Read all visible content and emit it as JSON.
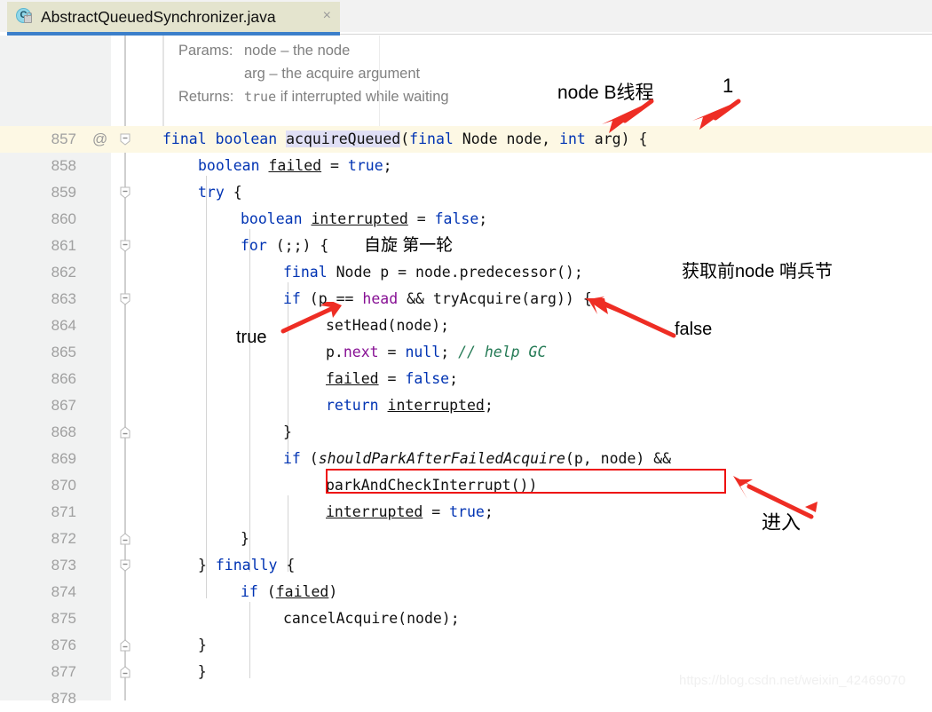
{
  "tab": {
    "title": "AbstractQueuedSynchronizer.java",
    "icon": "java-class-icon",
    "icon_letter": "C",
    "close_label": "×",
    "accent_color": "#3c7fca",
    "background_color": "#e4e4ce"
  },
  "doc_popup": {
    "rows": [
      {
        "label": "Params:",
        "value": "node – the node"
      },
      {
        "label": "",
        "value": "arg – the acquire argument"
      },
      {
        "label": "Returns:",
        "value_mono": "true",
        "value": " if interrupted while waiting"
      }
    ]
  },
  "editor": {
    "highlight_line": 857,
    "lines": [
      {
        "no": "857",
        "at": "@",
        "fold": "down",
        "highlight": true,
        "text": "    final boolean acquireQueued(final Node node, int arg) {"
      },
      {
        "no": "858",
        "at": "",
        "fold": "",
        "text": "        boolean failed = true;"
      },
      {
        "no": "859",
        "at": "",
        "fold": "down",
        "text": "        try {"
      },
      {
        "no": "860",
        "at": "",
        "fold": "",
        "text": "            boolean interrupted = false;"
      },
      {
        "no": "861",
        "at": "",
        "fold": "down",
        "text": "            for (;;) {"
      },
      {
        "no": "862",
        "at": "",
        "fold": "",
        "text": "                final Node p = node.predecessor();"
      },
      {
        "no": "863",
        "at": "",
        "fold": "down",
        "text": "                if (p == head && tryAcquire(arg)) {"
      },
      {
        "no": "864",
        "at": "",
        "fold": "",
        "text": "                    setHead(node);"
      },
      {
        "no": "865",
        "at": "",
        "fold": "",
        "text": "                    p.next = null; // help GC"
      },
      {
        "no": "866",
        "at": "",
        "fold": "",
        "text": "                    failed = false;"
      },
      {
        "no": "867",
        "at": "",
        "fold": "",
        "text": "                    return interrupted;"
      },
      {
        "no": "868",
        "at": "",
        "fold": "up",
        "text": "                }"
      },
      {
        "no": "869",
        "at": "",
        "fold": "",
        "text": "                if (shouldParkAfterFailedAcquire(p, node) &&"
      },
      {
        "no": "870",
        "at": "",
        "fold": "",
        "text": "                    parkAndCheckInterrupt())"
      },
      {
        "no": "871",
        "at": "",
        "fold": "",
        "text": "                    interrupted = true;"
      },
      {
        "no": "872",
        "at": "",
        "fold": "up",
        "text": "            }"
      },
      {
        "no": "873",
        "at": "",
        "fold": "down",
        "text": "        } finally {"
      },
      {
        "no": "874",
        "at": "",
        "fold": "",
        "text": "            if (failed)"
      },
      {
        "no": "875",
        "at": "",
        "fold": "",
        "text": "                cancelAcquire(node);"
      },
      {
        "no": "876",
        "at": "",
        "fold": "up",
        "text": "        }"
      },
      {
        "no": "877",
        "at": "",
        "fold": "up",
        "text": "    }"
      },
      {
        "no": "878",
        "at": "",
        "fold": "",
        "text": ""
      }
    ],
    "inline_comment_861": "自旋 第一轮"
  },
  "annotations": {
    "node_b_thread": "node B线程",
    "one": "1",
    "true_label": "true",
    "false_label": "false",
    "get_prev_node": "获取前node 哨兵节",
    "enter": "进入",
    "arrow_color": "#ee2d24",
    "box_color": "#ee1111"
  },
  "watermark": "https://blog.csdn.net/weixin_42469070"
}
